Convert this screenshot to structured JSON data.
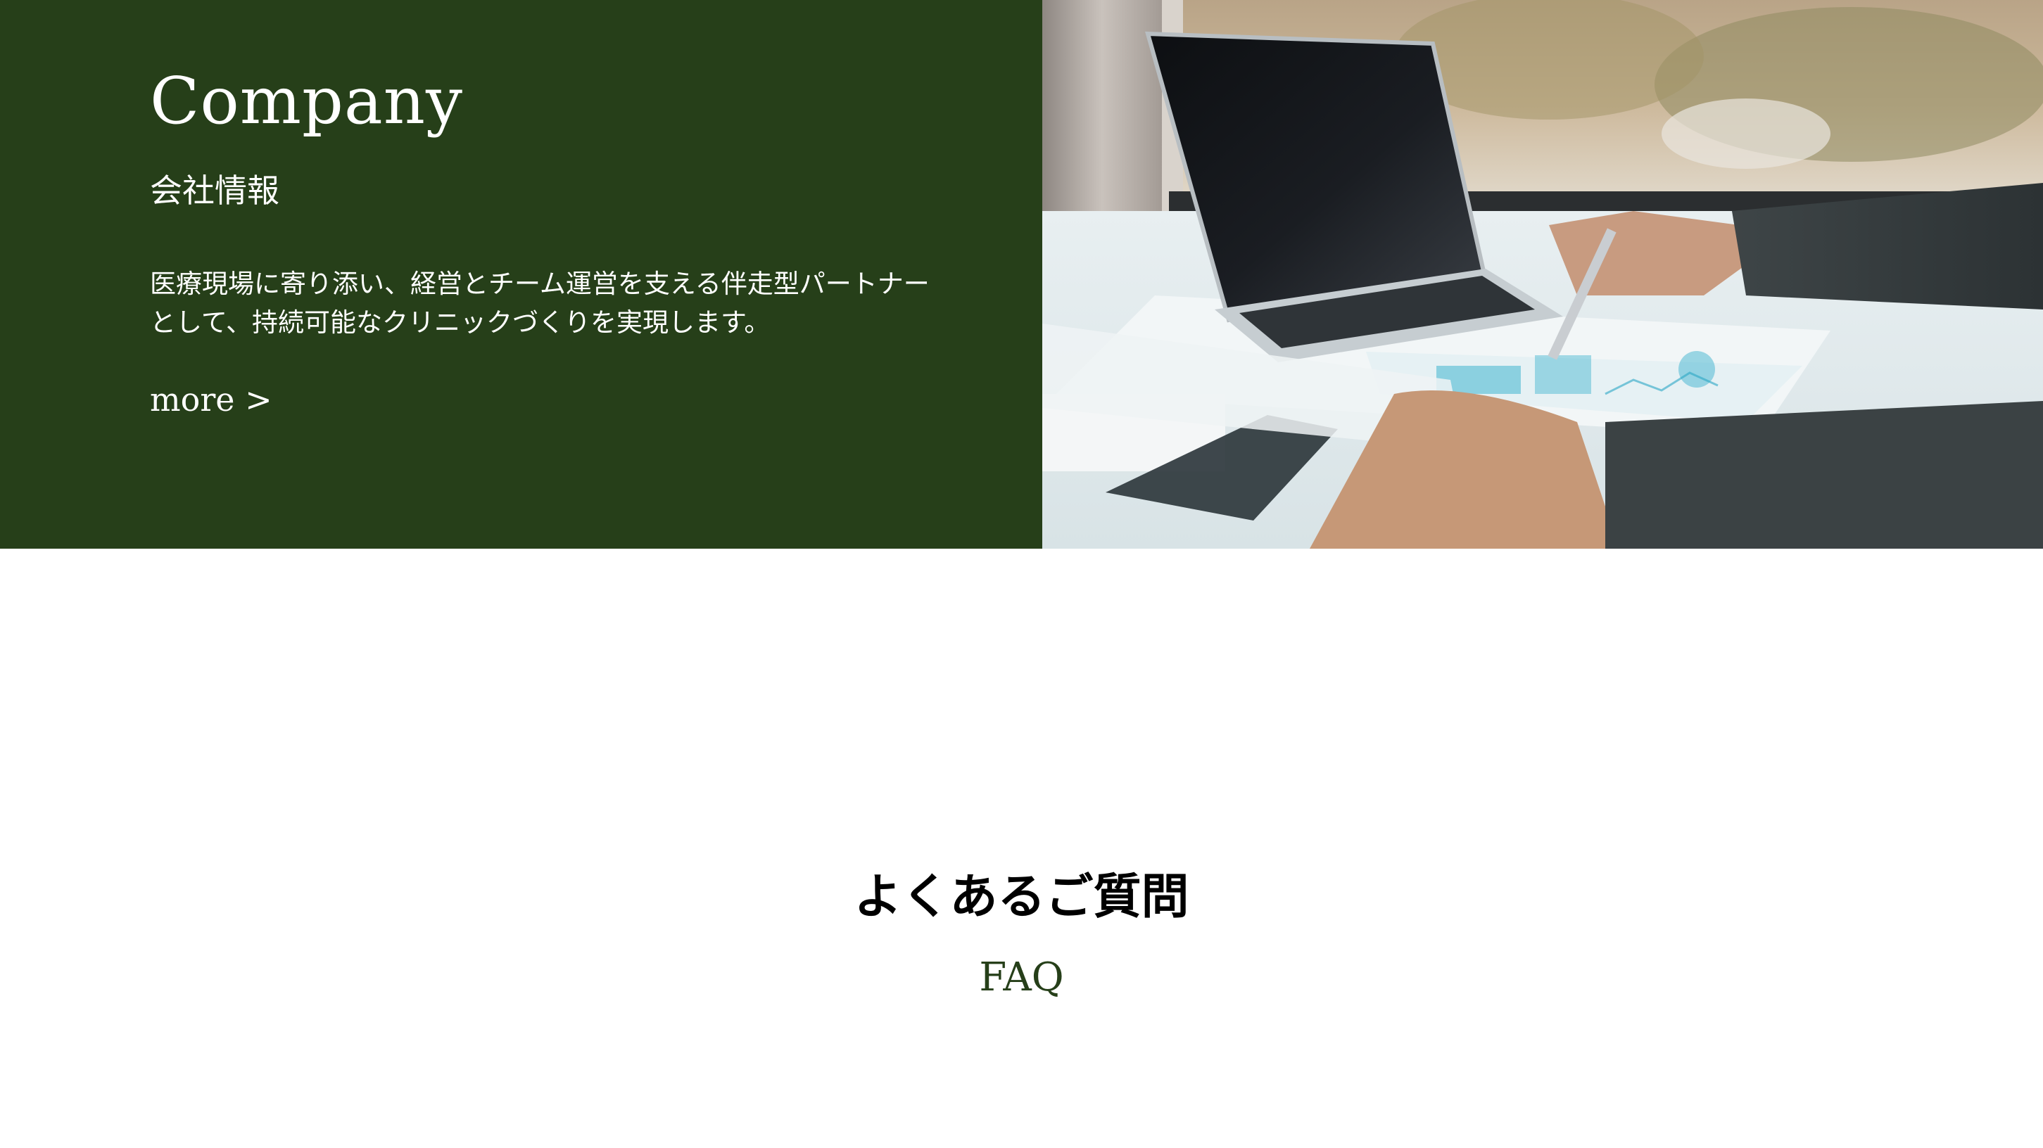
{
  "company": {
    "title": "Company",
    "subtitle": "会社情報",
    "description_lines": [
      "医療現場に寄り添い、経営とチーム運営を支える伴走型パートナー",
      "として、持続可能なクリニックづくりを実現します。"
    ],
    "more_link": "more >",
    "panel_color": "#263f19",
    "image": "laptop-desk-document-photo"
  },
  "faq": {
    "title": "よくあるご質問",
    "subtitle": "FAQ",
    "subtitle_color": "#263f19"
  }
}
